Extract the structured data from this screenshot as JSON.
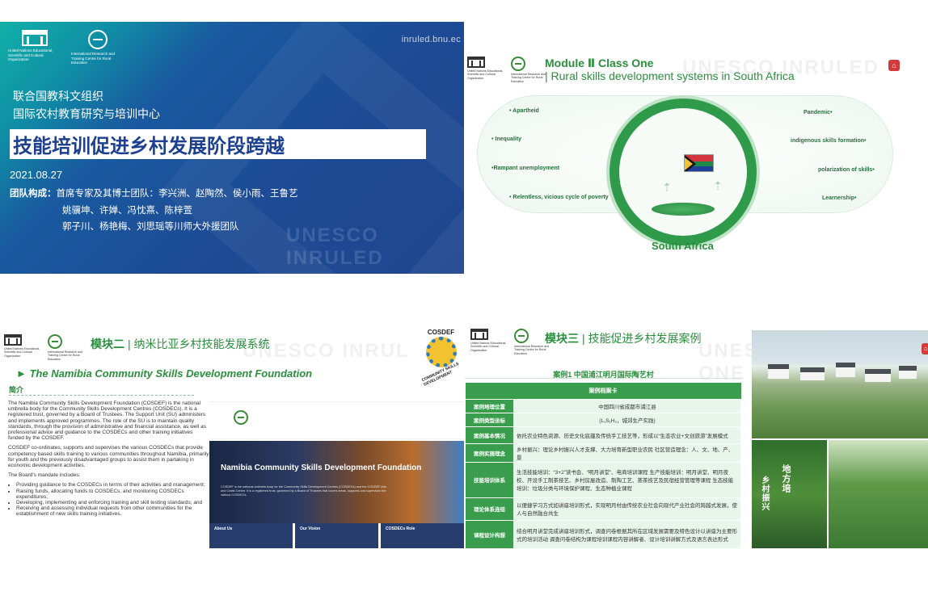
{
  "slide1": {
    "url": "inruled.bnu.ec",
    "logo_left": "United Nations Educational, Scientific and Cultural Organization",
    "logo_right": "International Research and Training Centre for Rural Education",
    "org_line1": "联合国教科文组织",
    "org_line2": "国际农村教育研究与培训中心",
    "title": "技能培训促进乡村发展阶段跨越",
    "date": "2021.08.27",
    "team_label": "团队构成：",
    "team_line1": "首席专家及其博士团队：李兴洲、赵陶然、侯小雨、王鲁艺",
    "team_line2": "姚骥坤、许婵、冯忱熹、陈梓萱",
    "team_line3": "郭子川、杨艳梅、刘思瑶等川师大外援团队",
    "watermark": "UNESCO INRULED"
  },
  "slide2": {
    "module": "Module Ⅱ Class One",
    "subtitle": "| Rural skills development systems in South Africa",
    "watermark": "UNESCO INRULED",
    "left_items": [
      "• Apartheid",
      "• Inequality",
      "•Rampant unemployment",
      "• Relentless, vicious cycle of poverty"
    ],
    "right_items": [
      "Pandemic•",
      "indigenous skills formation•",
      "polarization of skills•",
      "Learnership•"
    ],
    "country": "South Africa",
    "colors": {
      "accent": "#2a8f3c",
      "circle": "#2f9a4a"
    }
  },
  "slide3": {
    "module": "模块二",
    "module_title": "| 纳米比亚乡村技能发展系统",
    "watermark": "UNESCO INRUL",
    "cosdef": "COSDEF",
    "cosdef_arc": "COMMUNITY SKILLS DEVELOPMENT",
    "heading": "► The Namibia Community Skills Development Foundation",
    "section": "简介",
    "para1": "The Namibia Community Skills Development Foundation (COSDEF) is the national umbrella body for the Community Skills Development Centres (COSDECs). It is a registered trust, governed by a Board of Trustees. The Support Unit (SU) administers and implements approved programmes. The role of the SU is to maintain quality standards, through the provision of administrative and financial assistance, as well as professional advice and guidance to the COSDECs and other training initiatives funded by the COSDEF.",
    "para2": "COSDEF co-ordinates, supports and supervises the various COSDECs that provide competency based skills training to various communities throughout Namibia, primarily for youth and the previously disadvantaged groups to assist them in partaking in economic development activities.",
    "para3": "The Board's mandate includes:",
    "bullets": [
      "Providing guidance to the COSDECs in terms of their activities and management;",
      "Raising funds, allocating funds to COSDECs, and monitoring COSDECs expenditures;",
      "Developing, implementing and enforcing training and skill testing standards; and",
      "Receiving and assessing individual requests from other communities for the establishment of new skills training initiatives."
    ],
    "hero_title": "Namibia Community Skills Development Foundation",
    "hero_text": "COSDEF is the national umbrella body for the Community Skills Development Centres (COSDECs) and the COSDEF Arts and Crafts Centre. It is a registered trust, governed by a Board of Trustees that covers areas, supports and supervises the various COSDECs.",
    "foot": [
      "About Us",
      "Our Vision",
      "COSDECs Role"
    ],
    "colors": {
      "accent": "#2a8f3c",
      "nav": "#273d6e"
    }
  },
  "slide4": {
    "module": "模块三",
    "module_title": "| 技能促进乡村发展案例",
    "watermark": "UNESCO INRULED ONE",
    "case_title": "案例1 中国浦江明月国际陶艺村",
    "table_header": "案例档案卡",
    "rows": [
      {
        "k": "案例地理位置",
        "v": "中国四川省成都市浦江县"
      },
      {
        "k": "案例类型坐标",
        "v": "(L₁S₁H₂，城郊生产实践)"
      },
      {
        "k": "案例基本情况",
        "v": "依托农业特色资源、历史文化底蕴及传统手工技艺等，形成以“生态农业+文创旅游”发展模式"
      },
      {
        "k": "案例实施理念",
        "v": "乡村振兴：理论乡村振兴人才支撑、大力培育新型职业农民 社区营造理念：人、文、地、产、景"
      },
      {
        "k": "技能培训体系",
        "v": "生活技能培训：“3+2”读书会、“明月讲堂”、电商培训课程 生产技能培训：明月讲堂、明月夜校、开设手工制茶技艺、乡村房屋改造、制陶工艺、蒸茶技艺及民宿经营管理等课程 生态技能培训：垃圾分类与环境保护课程、生态种植业课程"
      },
      {
        "k": "理论体系连结",
        "v": "以便捷学习方式如讲座培训形式，实现明月村由传统农业社会向现代产业社会的跨越式发展，使人与自然融合共生"
      },
      {
        "k": "课程设计构想",
        "v": "结合明月讲堂完成讲座培训形式，调查问卷根据其所在区域发展需要及特色设计以讲座为主要形式的培训活动 调查问卷结构为课程培训课程内容讲解者、设计培训讲解方式及语言表达形式"
      }
    ],
    "photo_text1": "地方培",
    "photo_text2": "乡村振兴",
    "colors": {
      "accent": "#2a8f3c",
      "key": "#3a9d4e",
      "cell": "#e8f5ea"
    }
  }
}
